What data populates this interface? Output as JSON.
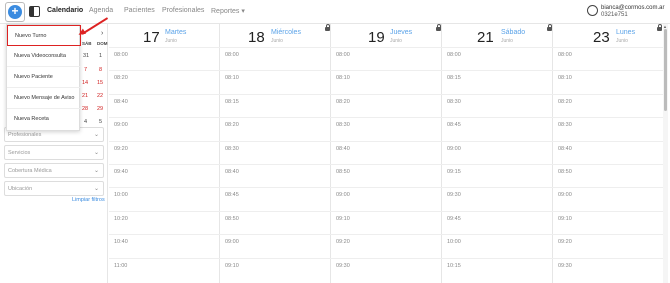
{
  "header": {
    "nav": [
      "Calendario",
      "Agenda",
      "Pacientes",
      "Profesionales",
      "Reportes"
    ],
    "user_email": "bianca@cormos.com.ar",
    "user_phone": "0321e751"
  },
  "dropdown": {
    "items": [
      "Nuevo Turno",
      "Nueva Videoconsulta",
      "Nuevo Paciente",
      "Nuevo Mensaje de Aviso",
      "Nueva Receta"
    ]
  },
  "mini_calendar": {
    "headers": [
      "SÁB",
      "DOM"
    ],
    "rows": [
      [
        "31",
        "1"
      ],
      [
        "7",
        "8"
      ],
      [
        "14",
        "15"
      ],
      [
        "21",
        "22"
      ],
      [
        "28",
        "29"
      ],
      [
        "4",
        "5"
      ]
    ]
  },
  "filters": [
    "Profesionales",
    "Servicios",
    "Cobertura Médica",
    "Ubicación"
  ],
  "clear_filters": "Limpiar filtros",
  "days": [
    {
      "num": "17",
      "name": "Martes",
      "month": "Junio",
      "times": [
        "08:00",
        "08:20",
        "08:40",
        "09:00",
        "09:20",
        "09:40",
        "10:00",
        "10:20",
        "10:40",
        "11:00"
      ]
    },
    {
      "num": "18",
      "name": "Miércoles",
      "month": "Junio",
      "times": [
        "08:00",
        "08:10",
        "08:15",
        "08:20",
        "08:30",
        "08:40",
        "08:45",
        "08:50",
        "09:00",
        "09:10"
      ]
    },
    {
      "num": "19",
      "name": "Jueves",
      "month": "Junio",
      "times": [
        "08:00",
        "08:10",
        "08:20",
        "08:30",
        "08:40",
        "08:50",
        "09:00",
        "09:10",
        "09:20",
        "09:30"
      ]
    },
    {
      "num": "21",
      "name": "Sábado",
      "month": "Junio",
      "times": [
        "08:00",
        "08:15",
        "08:30",
        "08:45",
        "09:00",
        "09:15",
        "09:30",
        "09:45",
        "10:00",
        "10:15"
      ]
    },
    {
      "num": "23",
      "name": "Lunes",
      "month": "Junio",
      "times": [
        "08:00",
        "08:10",
        "08:20",
        "08:30",
        "08:40",
        "08:50",
        "09:00",
        "09:10",
        "09:20",
        "09:30"
      ]
    }
  ]
}
